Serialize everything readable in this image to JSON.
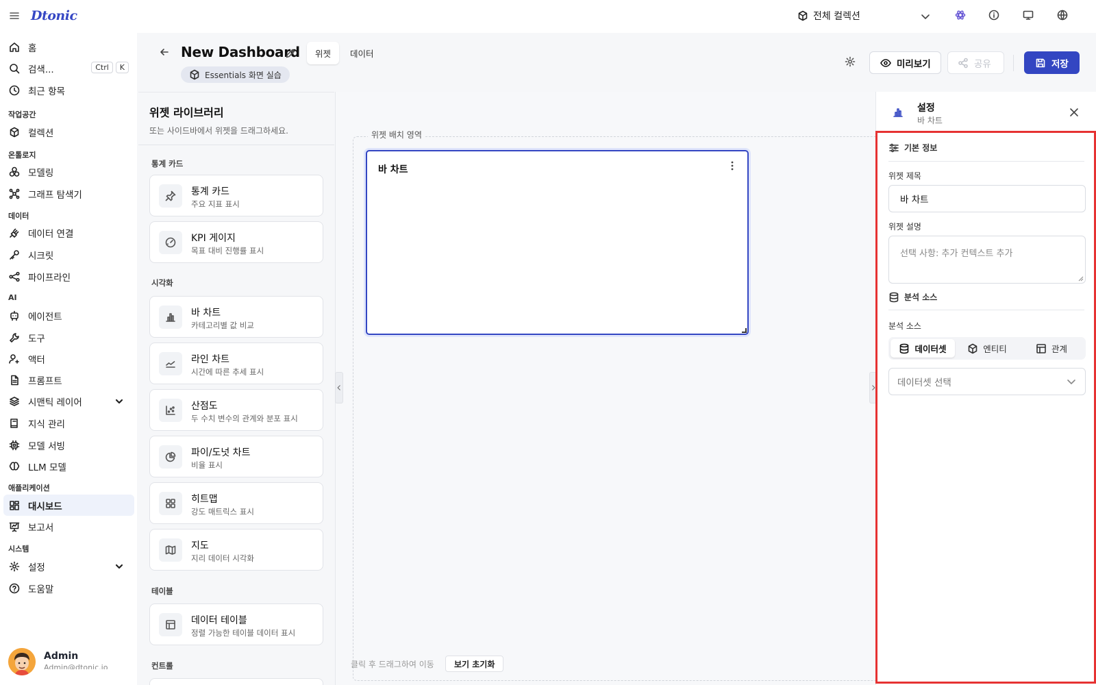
{
  "app": {
    "logo": "Dtonic"
  },
  "topbar": {
    "collection_label": "전체 컬렉션"
  },
  "sidebar": {
    "items": [
      {
        "label": "홈"
      },
      {
        "label": "검색..."
      },
      {
        "label": "최근 항목"
      },
      {
        "label": "컬렉션"
      },
      {
        "label": "모델링"
      },
      {
        "label": "그래프 탐색기"
      },
      {
        "label": "데이터 연결"
      },
      {
        "label": "시크릿"
      },
      {
        "label": "파이프라인"
      },
      {
        "label": "에이전트"
      },
      {
        "label": "도구"
      },
      {
        "label": "액터"
      },
      {
        "label": "프롬프트"
      },
      {
        "label": "시맨틱 레이어"
      },
      {
        "label": "지식 관리"
      },
      {
        "label": "모델 서빙"
      },
      {
        "label": "LLM 모델"
      },
      {
        "label": "대시보드"
      },
      {
        "label": "보고서"
      },
      {
        "label": "설정"
      },
      {
        "label": "도움말"
      }
    ],
    "sections": [
      "작업공간",
      "온톨로지",
      "데이터",
      "AI",
      "애플리케이션",
      "시스템"
    ],
    "search_shortcut": [
      "Ctrl",
      "K"
    ],
    "user": {
      "name": "Admin",
      "email": "Admin@dtonic.io"
    }
  },
  "header": {
    "title": "New Dashboard",
    "tabs": [
      {
        "label": "위젯"
      },
      {
        "label": "데이터"
      }
    ],
    "collection_badge": "Essentials 화면 실습",
    "preview_label": "미리보기",
    "share_label": "공유",
    "save_label": "저장"
  },
  "library": {
    "title": "위젯 라이브러리",
    "subtitle": "또는 사이드바에서 위젯을 드래그하세요.",
    "sections": [
      {
        "title": "통계 카드",
        "items": [
          {
            "title": "통계 카드",
            "desc": "주요 지표 표시",
            "icon": "pin-icon"
          },
          {
            "title": "KPI 게이지",
            "desc": "목표 대비 진행률 표시",
            "icon": "gauge-icon"
          }
        ]
      },
      {
        "title": "시각화",
        "items": [
          {
            "title": "바 차트",
            "desc": "카테고리별 값 비교",
            "icon": "bar-chart-icon"
          },
          {
            "title": "라인 차트",
            "desc": "시간에 따른 추세 표시",
            "icon": "line-chart-icon"
          },
          {
            "title": "산점도",
            "desc": "두 수치 변수의 관계와 분포 표시",
            "icon": "scatter-icon"
          },
          {
            "title": "파이/도넛 차트",
            "desc": "비율 표시",
            "icon": "pie-chart-icon"
          },
          {
            "title": "히트맵",
            "desc": "강도 매트릭스 표시",
            "icon": "heatmap-icon"
          },
          {
            "title": "지도",
            "desc": "지리 데이터 시각화",
            "icon": "map-icon"
          }
        ]
      },
      {
        "title": "테이블",
        "items": [
          {
            "title": "데이터 테이블",
            "desc": "정렬 가능한 테이블 데이터 표시",
            "icon": "table-icon"
          }
        ]
      },
      {
        "title": "컨트롤",
        "items": []
      }
    ]
  },
  "canvas": {
    "area_label": "위젯 배치 영역",
    "widget_title": "바 차트",
    "hint": "클릭 후 드래그하여 이동",
    "reset_label": "보기 초기화"
  },
  "settings": {
    "title": "설정",
    "subtitle": "바 차트",
    "basic_section": "기본 정보",
    "title_label": "위젯 제목",
    "title_value": "바 차트",
    "desc_label": "위젯 설명",
    "desc_placeholder": "선택 사항: 추가 컨텍스트 추가",
    "source_section": "분석 소스",
    "source_label": "분석 소스",
    "source_options": [
      "데이터셋",
      "엔티티",
      "관계"
    ],
    "dataset_placeholder": "데이터셋 선택"
  },
  "colors": {
    "accent": "#3346c2",
    "highlight": "#e63232"
  }
}
